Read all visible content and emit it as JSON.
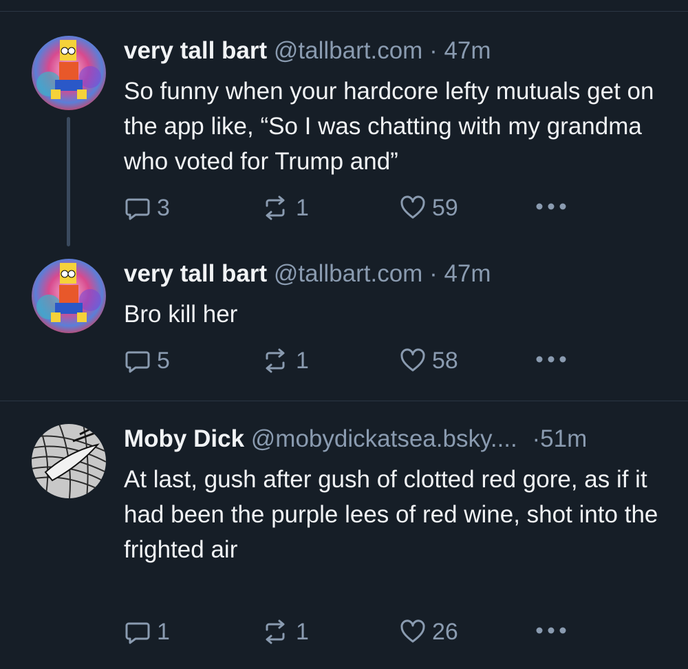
{
  "posts": [
    {
      "author": "very tall bart",
      "handle": "@tallbart.com",
      "separator": "·",
      "time": "47m",
      "text": "So funny when your hardcore lefty mutuals get on the app like, “So I was chatting with my grandma who voted for Trump and”",
      "replies": "3",
      "reposts": "1",
      "likes": "59"
    },
    {
      "author": "very tall bart",
      "handle": "@tallbart.com",
      "separator": "·",
      "time": "47m",
      "text": "Bro kill her",
      "replies": "5",
      "reposts": "1",
      "likes": "58"
    },
    {
      "author": "Moby Dick",
      "handle": "@mobydickatsea.bsky....",
      "separator": "·",
      "time": "51m",
      "text": "At last, gush after gush of clotted red gore, as if it had been the purple lees of red wine, shot into the frighted air",
      "replies": "1",
      "reposts": "1",
      "likes": "26"
    }
  ],
  "colors": {
    "background": "#161e27",
    "text": "#f1f3f5",
    "muted": "#8a9bb0",
    "divider": "#2b3644",
    "thread_line": "#3a4a5e"
  },
  "icons": {
    "reply": "speech-bubble-icon",
    "repost": "repost-arrows-icon",
    "like": "heart-icon",
    "more": "ellipsis-icon"
  }
}
